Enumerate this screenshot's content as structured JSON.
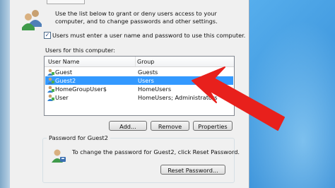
{
  "intro_text": "Use the list below to grant or deny users access to your computer, and to change passwords and other settings.",
  "require_password": {
    "label": "Users must enter a user name and password to use this computer.",
    "checked": true,
    "check_glyph": "✓"
  },
  "users_list": {
    "caption": "Users for this computer:",
    "columns": {
      "name": "User Name",
      "group": "Group"
    },
    "rows": [
      {
        "name": "Guest",
        "group": "Guests",
        "selected": false
      },
      {
        "name": "Guest2",
        "group": "Users",
        "selected": true
      },
      {
        "name": "HomeGroupUser$",
        "group": "HomeUsers",
        "selected": false
      },
      {
        "name": "User",
        "group": "HomeUsers; Administrators",
        "selected": false
      }
    ]
  },
  "buttons": {
    "add": "Add...",
    "remove": "Remove",
    "properties": "Properties",
    "reset_password": "Reset Password..."
  },
  "password_group": {
    "title": "Password for Guest2",
    "text": "To change the password for Guest2, click Reset Password."
  },
  "annotation": {
    "arrow_color": "#e8201c"
  },
  "icons": [
    "users-icon",
    "user-icon",
    "password-user-icon"
  ]
}
